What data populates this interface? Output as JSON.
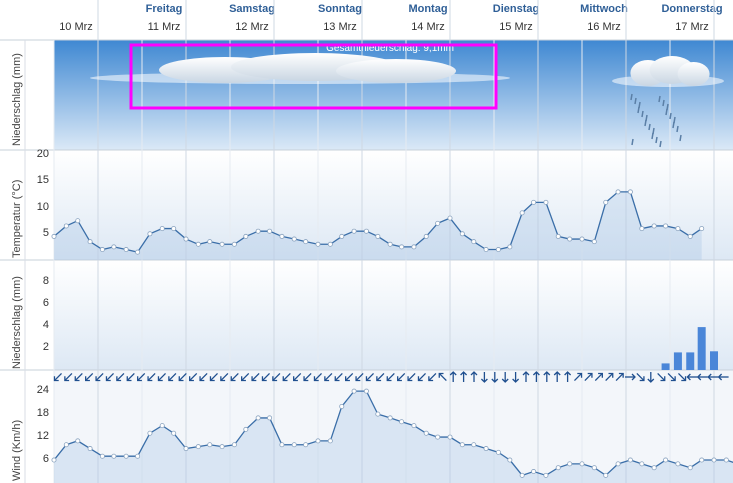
{
  "header": {
    "days": [
      {
        "day": "",
        "date": "10 Mrz"
      },
      {
        "day": "Freitag",
        "date": "11 Mrz"
      },
      {
        "day": "Samstag",
        "date": "12 Mrz"
      },
      {
        "day": "Sonntag",
        "date": "13 Mrz"
      },
      {
        "day": "Montag",
        "date": "14 Mrz"
      },
      {
        "day": "Dienstag",
        "date": "15 Mrz"
      },
      {
        "day": "Mittwoch",
        "date": "16 Mrz"
      },
      {
        "day": "Donnerstag",
        "date": "17 Mrz"
      }
    ]
  },
  "colors": {
    "line": "#3a6ea8",
    "bar": "#4a86d8",
    "arrow": "#1f4f8f",
    "highlight": "#ff00ff",
    "sky_top": "#3f88d2",
    "grid": "#cfd8e3"
  },
  "chart_data": [
    {
      "type": "line",
      "panel": "precipitation-overview",
      "ylabel": "Niederschlag (mm)",
      "annotation": "Gesamtniederschlag: 9,1mm"
    },
    {
      "type": "line",
      "panel": "temperature",
      "ylabel": "Temperatur (°C)",
      "yticks": [
        5,
        10,
        15,
        20
      ],
      "ylim": [
        0,
        21
      ],
      "x_day_fraction": [
        0.0,
        0.14,
        0.27,
        0.41,
        0.55,
        0.68,
        0.82,
        0.95,
        1.09,
        1.23,
        1.36,
        1.5,
        1.64,
        1.77,
        1.91,
        2.05,
        2.18,
        2.32,
        2.45,
        2.59,
        2.73,
        2.86,
        3.0,
        3.14,
        3.27,
        3.41,
        3.55,
        3.68,
        3.82,
        3.95,
        4.09,
        4.23,
        4.36,
        4.5,
        4.64,
        4.77,
        4.91,
        5.05,
        5.18,
        5.32,
        5.45,
        5.59,
        5.73,
        5.86,
        6.0,
        6.14,
        6.27,
        6.41,
        6.55,
        6.68,
        6.82,
        6.95,
        7.09,
        7.23,
        7.36
      ],
      "values": [
        4.5,
        6.5,
        7.5,
        3.5,
        2.0,
        2.5,
        2.0,
        1.5,
        5.0,
        6.0,
        6.0,
        4.0,
        3.0,
        3.5,
        3.0,
        3.0,
        4.5,
        5.5,
        5.5,
        4.5,
        4.0,
        3.5,
        3.0,
        3.0,
        4.5,
        5.5,
        5.5,
        4.5,
        3.0,
        2.5,
        2.5,
        4.5,
        7.0,
        8.0,
        5.0,
        3.5,
        2.0,
        2.0,
        2.5,
        9.0,
        11.0,
        11.0,
        4.5,
        4.0,
        4.0,
        3.5,
        11.0,
        13.0,
        13.0,
        6.0,
        6.5,
        6.5,
        6.0,
        4.5,
        6.0
      ]
    },
    {
      "type": "bar",
      "panel": "precipitation",
      "ylabel": "Niederschlag (mm)",
      "yticks": [
        2,
        4,
        6,
        8
      ],
      "ylim": [
        0,
        10
      ],
      "x_day_fraction": [
        6.95,
        7.09,
        7.23,
        7.36,
        7.5
      ],
      "values": [
        0.6,
        1.6,
        1.6,
        3.9,
        1.7
      ]
    },
    {
      "type": "line",
      "panel": "wind",
      "ylabel": "Wind (Km/h)",
      "yticks": [
        6,
        12,
        18,
        24
      ],
      "ylim": [
        0,
        29
      ],
      "x_day_fraction": [
        0.0,
        0.14,
        0.27,
        0.41,
        0.55,
        0.68,
        0.82,
        0.95,
        1.09,
        1.23,
        1.36,
        1.5,
        1.64,
        1.77,
        1.91,
        2.05,
        2.18,
        2.32,
        2.45,
        2.59,
        2.73,
        2.86,
        3.0,
        3.14,
        3.27,
        3.41,
        3.55,
        3.68,
        3.82,
        3.95,
        4.09,
        4.23,
        4.36,
        4.5,
        4.64,
        4.77,
        4.91,
        5.05,
        5.18,
        5.32,
        5.45,
        5.59,
        5.73,
        5.86,
        6.0,
        6.14,
        6.27,
        6.41,
        6.55,
        6.68,
        6.82,
        6.95,
        7.09,
        7.23,
        7.36,
        7.5,
        7.64,
        7.77,
        7.91,
        8.05
      ],
      "values": [
        6,
        10,
        11,
        9,
        7,
        7,
        7,
        7,
        13,
        15,
        13,
        9,
        9.5,
        10,
        9.5,
        10,
        14,
        17,
        17,
        10,
        10,
        10,
        11,
        11,
        20,
        24,
        24,
        18,
        17,
        16,
        15,
        13,
        12,
        12,
        10,
        10,
        9,
        8,
        6,
        2,
        3,
        2,
        4,
        5,
        5,
        4,
        2,
        5,
        6,
        5,
        4,
        6,
        5,
        4,
        6,
        6,
        6,
        5,
        3,
        5
      ]
    },
    {
      "type": "table",
      "panel": "wind-direction",
      "note": "wind arrows shown as rotation angles in degrees (0 = pointing up)",
      "angles": [
        225,
        225,
        225,
        225,
        225,
        225,
        225,
        225,
        225,
        225,
        225,
        225,
        225,
        225,
        225,
        225,
        225,
        225,
        225,
        225,
        225,
        225,
        225,
        225,
        225,
        225,
        225,
        225,
        225,
        225,
        225,
        225,
        225,
        225,
        225,
        225,
        225,
        315,
        0,
        0,
        0,
        180,
        180,
        180,
        180,
        0,
        0,
        0,
        0,
        0,
        45,
        45,
        45,
        45,
        45,
        90,
        135,
        180,
        135,
        135,
        135,
        270,
        270,
        270,
        270
      ]
    }
  ]
}
